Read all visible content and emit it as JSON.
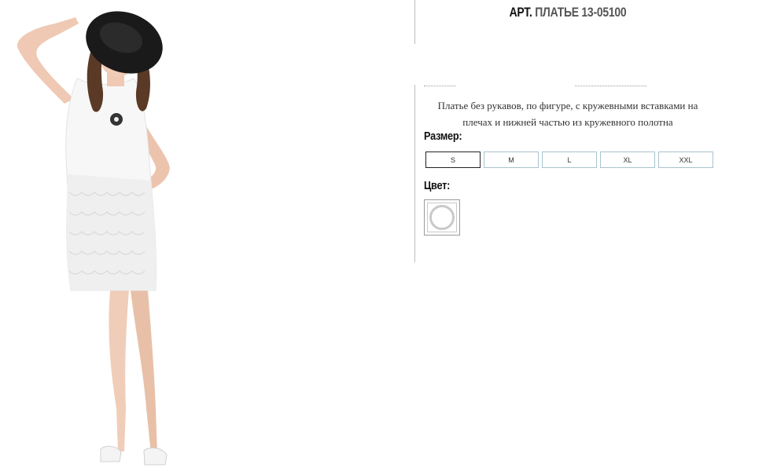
{
  "product": {
    "title_prefix": "Арт.",
    "title_name": "Платье 13-05100",
    "description": "Платье без рукавов, по фигуре, с кружевными вставками на плечах и нижней частью из кружевного полотна",
    "photo_icon": "product-photo"
  },
  "size_section": {
    "label": "Размер:",
    "options": [
      "S",
      "M",
      "L",
      "XL",
      "XXL"
    ],
    "selected": "S"
  },
  "color_section": {
    "label": "Цвет:",
    "swatch_color": "#ffffff"
  }
}
